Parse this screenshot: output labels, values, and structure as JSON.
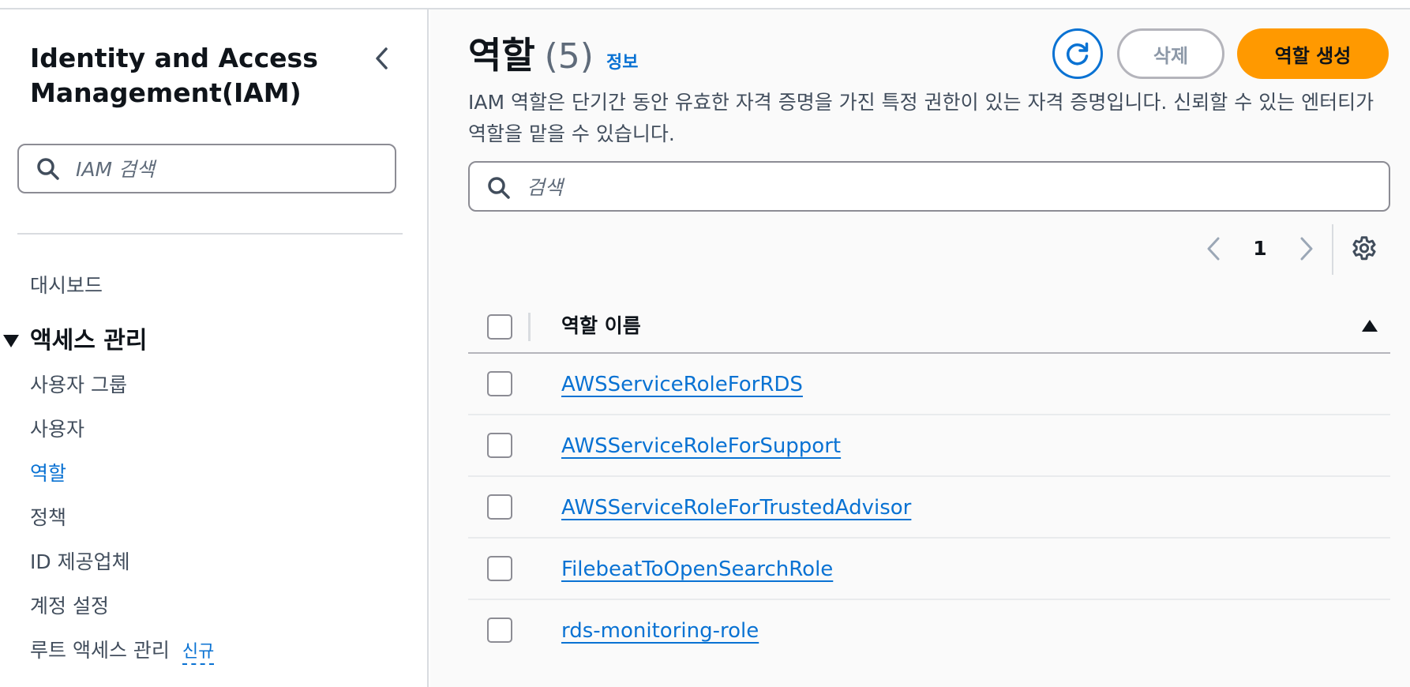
{
  "sidebar": {
    "title": "Identity and Access Management(IAM)",
    "search_placeholder": "IAM 검색",
    "items": {
      "dashboard": "대시보드",
      "section_access": "액세스 관리",
      "user_groups": "사용자 그룹",
      "users": "사용자",
      "roles": "역할",
      "policies": "정책",
      "identity_providers": "ID 제공업체",
      "account_settings": "계정 설정",
      "root_access": "루트 액세스 관리",
      "root_access_badge": "신규"
    }
  },
  "main": {
    "title": "역할",
    "count": "(5)",
    "info_link": "정보",
    "refresh_icon": "refresh-icon",
    "delete_label": "삭제",
    "create_label": "역할 생성",
    "description": "IAM 역할은 단기간 동안 유효한 자격 증명을 가진 특정 권한이 있는 자격 증명입니다. 신뢰할 수 있는 엔터티가 역할을 맡을 수 있습니다.",
    "search_placeholder": "검색",
    "pagination": {
      "current_page": "1"
    },
    "table": {
      "column_header": "역할 이름",
      "sort": "ascending",
      "rows": [
        {
          "name": "AWSServiceRoleForRDS"
        },
        {
          "name": "AWSServiceRoleForSupport"
        },
        {
          "name": "AWSServiceRoleForTrustedAdvisor"
        },
        {
          "name": "FilebeatToOpenSearchRole"
        },
        {
          "name": "rds-monitoring-role"
        }
      ]
    }
  },
  "colors": {
    "accent": "#0972d3",
    "primary_button": "#ff9900",
    "text": "#0f141a",
    "secondary_text": "#5f6b7a"
  }
}
